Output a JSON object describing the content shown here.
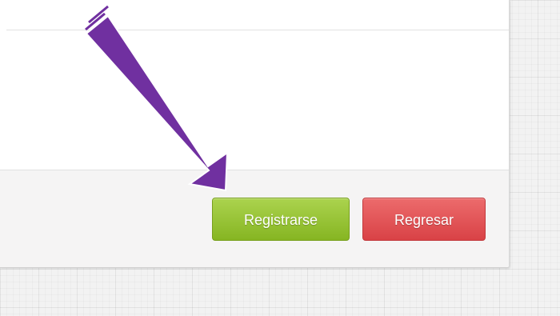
{
  "footer": {
    "register_label": "Registrarse",
    "back_label": "Regresar"
  },
  "annotation": {
    "arrow_color": "#7030a0"
  },
  "colors": {
    "register_button": "#95c33a",
    "back_button": "#e2575a",
    "page_background": "#f2f2f2"
  }
}
